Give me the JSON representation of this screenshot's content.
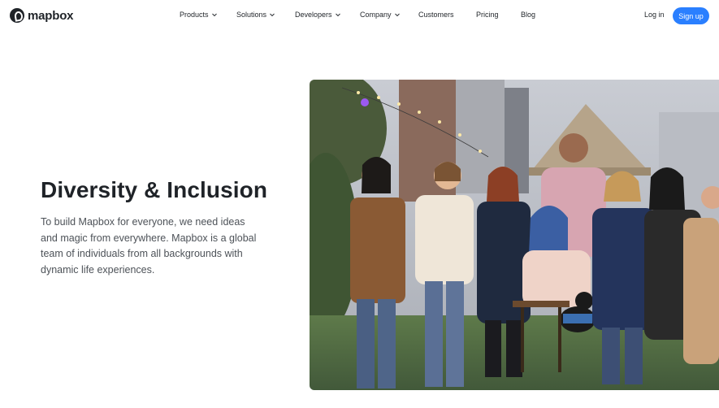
{
  "brand": {
    "name": "mapbox",
    "accent": "#2a7fff"
  },
  "nav": {
    "items": [
      {
        "label": "Products",
        "dropdown": true
      },
      {
        "label": "Solutions",
        "dropdown": true
      },
      {
        "label": "Developers",
        "dropdown": true
      },
      {
        "label": "Company",
        "dropdown": true
      },
      {
        "label": "Customers",
        "dropdown": false
      },
      {
        "label": "Pricing",
        "dropdown": false
      },
      {
        "label": "Blog",
        "dropdown": false
      }
    ],
    "login": "Log in",
    "signup": "Sign up"
  },
  "hero": {
    "title": "Diversity & Inclusion",
    "description": "To build Mapbox for everyone, we need ideas and magic from everywhere. Mapbox is a global team of individuals from all backgrounds with dynamic life experiences.",
    "image_icon": "group-photo"
  }
}
